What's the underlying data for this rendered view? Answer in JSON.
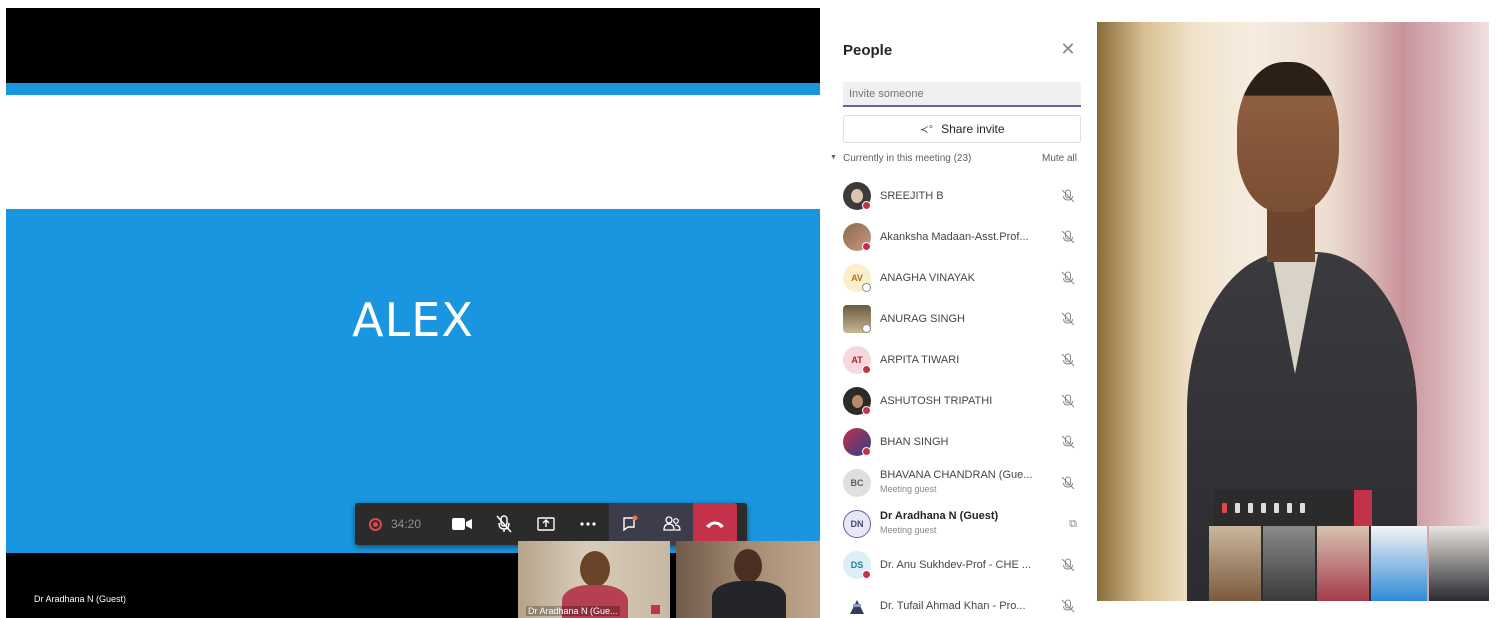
{
  "meeting": {
    "slide_title": "ALEX",
    "timer": "34:20",
    "stage_name": "Dr Aradhana N (Guest)",
    "thumbnails": [
      {
        "label": "Dr Aradhana N (Gue..."
      },
      {
        "label": ""
      }
    ],
    "toolbar_icons": [
      "record-icon",
      "camera-icon",
      "mic-off-icon",
      "share-screen-icon",
      "more-icon",
      "chat-icon",
      "people-icon",
      "hang-up-icon"
    ],
    "colors": {
      "slide_blue": "#1a96e0",
      "hangup_red": "#c4314b",
      "toolbar_bg": "#2b2b2b",
      "accent": "#6264a7"
    }
  },
  "people_panel": {
    "title": "People",
    "invite_placeholder": "Invite someone",
    "share_label": "Share invite",
    "section_label": "Currently in this meeting (23)",
    "mute_all": "Mute all",
    "participants": [
      {
        "name": "SREEJITH B",
        "initials": "",
        "sub": "",
        "status": "busy"
      },
      {
        "name": "Akanksha Madaan-Asst.Prof...",
        "initials": "",
        "sub": "",
        "status": "busy"
      },
      {
        "name": "ANAGHA VINAYAK",
        "initials": "AV",
        "sub": "",
        "status": "away"
      },
      {
        "name": "ANURAG SINGH",
        "initials": "",
        "sub": "",
        "status": "away"
      },
      {
        "name": "ARPITA TIWARI",
        "initials": "AT",
        "sub": "",
        "status": "busy"
      },
      {
        "name": "ASHUTOSH TRIPATHI",
        "initials": "",
        "sub": "",
        "status": "busy"
      },
      {
        "name": "BHAN SINGH",
        "initials": "",
        "sub": "",
        "status": "busy"
      },
      {
        "name": "BHAVANA CHANDRAN (Gue...",
        "initials": "BC",
        "sub": "Meeting guest",
        "status": ""
      },
      {
        "name": "Dr Aradhana N (Guest)",
        "initials": "DN",
        "sub": "Meeting guest",
        "status": ""
      },
      {
        "name": "Dr. Anu Sukhdev-Prof - CHE ...",
        "initials": "DS",
        "sub": "",
        "status": "busy"
      },
      {
        "name": "Dr. Tufail Ahmad Khan - Pro...",
        "initials": "",
        "sub": "",
        "status": ""
      }
    ]
  }
}
